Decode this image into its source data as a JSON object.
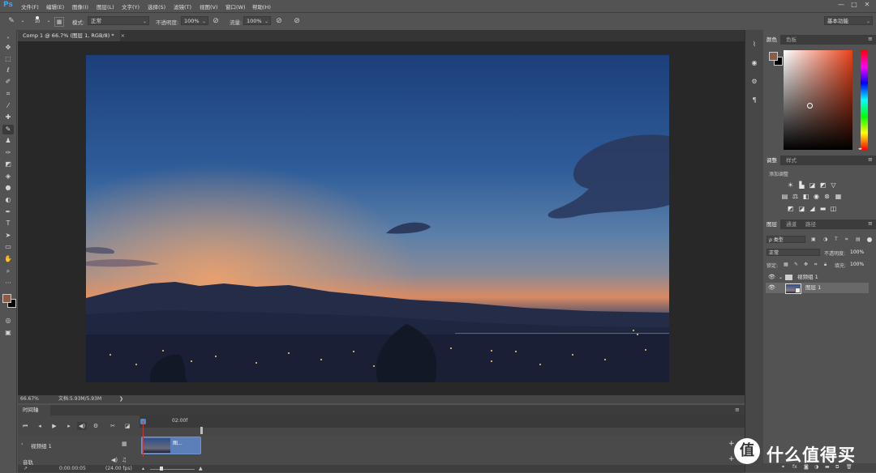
{
  "app": {
    "logo": "Ps"
  },
  "menu": [
    "文件(F)",
    "编辑(E)",
    "图像(I)",
    "图层(L)",
    "文字(Y)",
    "选择(S)",
    "滤镜(T)",
    "视图(V)",
    "窗口(W)",
    "帮助(H)"
  ],
  "window_controls": [
    "—",
    "□",
    "✕"
  ],
  "options_bar": {
    "brush_size": "10",
    "mode_label": "模式:",
    "mode_value": "正常",
    "opacity_label": "不透明度:",
    "opacity_value": "100%",
    "flow_label": "流量:",
    "flow_value": "100%",
    "workspace": "基本功能"
  },
  "document": {
    "tab_title": "Comp 1 @ 66.7% (图层 1, RGB/8) *",
    "zoom": "66.67%",
    "doc_info": "文档:5.93M/5.93M"
  },
  "timeline": {
    "tab_label": "时间轴",
    "time_marker": "02:00f",
    "track_label": "视频组 1",
    "clip_label": "图...",
    "audio_label": "音轨",
    "timecode": "0:00:00:05",
    "fps": "(24.00 fps)"
  },
  "color_panel": {
    "tabs": [
      "颜色",
      "色板"
    ],
    "foreground": "#8a5c4a",
    "background": "#000000"
  },
  "adjustments_panel": {
    "tabs": [
      "调整",
      "样式"
    ],
    "title": "添加调整"
  },
  "layers_panel": {
    "tabs": [
      "图层",
      "通道",
      "路径"
    ],
    "filter_label": "ρ 类型",
    "blend_mode": "正常",
    "opacity_label": "不透明度:",
    "opacity_value": "100%",
    "lock_label": "锁定:",
    "fill_label": "填充:",
    "fill_value": "100%",
    "layers": [
      {
        "name": "视频组 1",
        "type": "group"
      },
      {
        "name": "图层 1",
        "type": "layer",
        "selected": true
      }
    ]
  },
  "watermark": {
    "brand": "什么值得买"
  },
  "colors": {
    "accent": "#31a8ff",
    "clip": "#5b7fb8",
    "playhead": "#c43a3a"
  }
}
